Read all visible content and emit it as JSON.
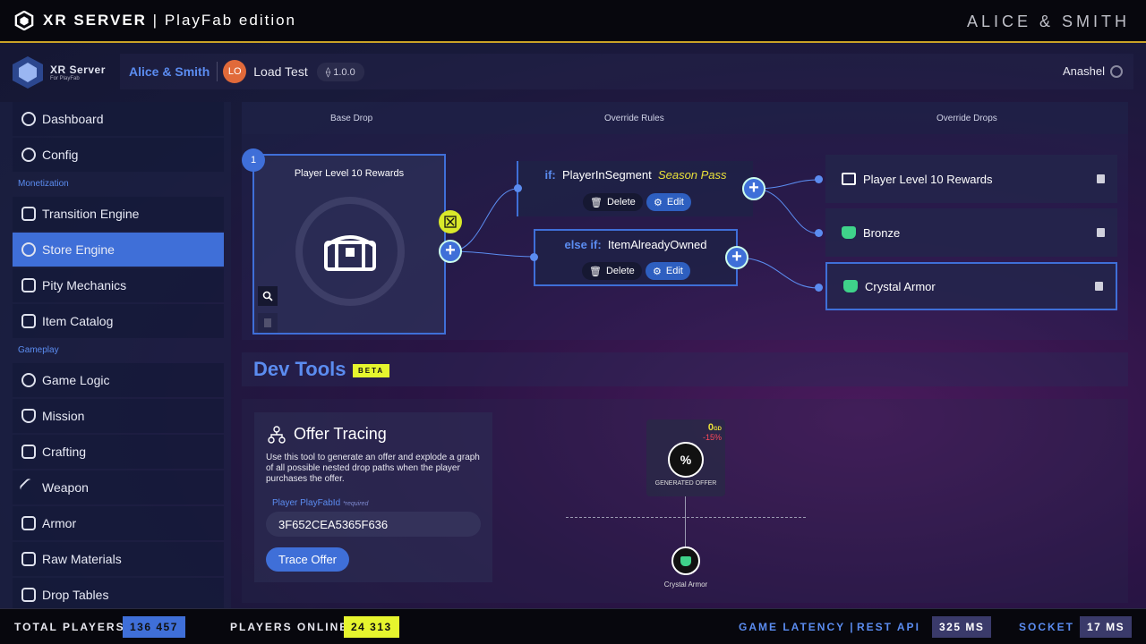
{
  "topbar": {
    "app_title": "XR SERVER",
    "edition": "PlayFab edition",
    "brand": "ALICE & SMITH"
  },
  "logo": {
    "title": "XR Server",
    "subtitle": "For PlayFab"
  },
  "header": {
    "org": "Alice & Smith",
    "avatar": "LO",
    "project": "Load Test",
    "version": "1.0.0",
    "user": "Anashel"
  },
  "sidebar": {
    "items": [
      {
        "label": "Dashboard"
      },
      {
        "label": "Config"
      },
      {
        "label": "Transition Engine"
      },
      {
        "label": "Store Engine"
      },
      {
        "label": "Pity Mechanics"
      },
      {
        "label": "Item Catalog"
      },
      {
        "label": "Game Logic"
      },
      {
        "label": "Mission"
      },
      {
        "label": "Crafting"
      },
      {
        "label": "Weapon"
      },
      {
        "label": "Armor"
      },
      {
        "label": "Raw Materials"
      },
      {
        "label": "Drop Tables"
      }
    ],
    "sections": {
      "monetization": "Monetization",
      "gameplay": "Gameplay"
    },
    "active": "Store Engine"
  },
  "editor": {
    "columns": {
      "base": "Base Drop",
      "rules": "Override Rules",
      "drops": "Override Drops"
    },
    "base_index": "1",
    "base_label": "Player Level 10 Rewards",
    "rules": [
      {
        "keyword": "if:",
        "condition": "PlayerInSegment",
        "segment": "Season Pass",
        "delete": "Delete",
        "edit": "Edit"
      },
      {
        "keyword": "else if:",
        "condition": "ItemAlreadyOwned",
        "segment": "",
        "delete": "Delete",
        "edit": "Edit"
      }
    ],
    "drops": [
      {
        "label": "Player Level 10 Rewards",
        "icon": "chest-icon"
      },
      {
        "label": "Bronze",
        "icon": "armor-icon"
      },
      {
        "label": "Crystal Armor",
        "icon": "armor-icon"
      }
    ]
  },
  "devtools": {
    "title": "Dev Tools",
    "badge": "BETA",
    "tracer": {
      "title": "Offer Tracing",
      "description": "Use this tool to generate an offer and explode a graph of all possible nested drop paths when the player purchases the offer.",
      "label": "Player PlayFabId",
      "required": "*required",
      "value": "3F652CEA5365F636",
      "button": "Trace Offer"
    },
    "graph": {
      "price": "0",
      "currency": "GD",
      "discount": "-15%",
      "root_label": "GENERATED OFFER",
      "leaf_label": "Crystal Armor"
    }
  },
  "status": {
    "total_players_label": "TOTAL PLAYERS",
    "total_players": "136 457",
    "online_label": "PLAYERS ONLINE",
    "online": "24 313",
    "latency_label": "GAME LATENCY |",
    "rest_label": "REST API",
    "rest_value": "325 MS",
    "socket_label": "SOCKET",
    "socket_value": "17 MS"
  },
  "colors": {
    "accent": "#3f6fd8",
    "highlight": "#e6f52e",
    "gold": "#c9a227",
    "warning": "#e9e03a"
  }
}
